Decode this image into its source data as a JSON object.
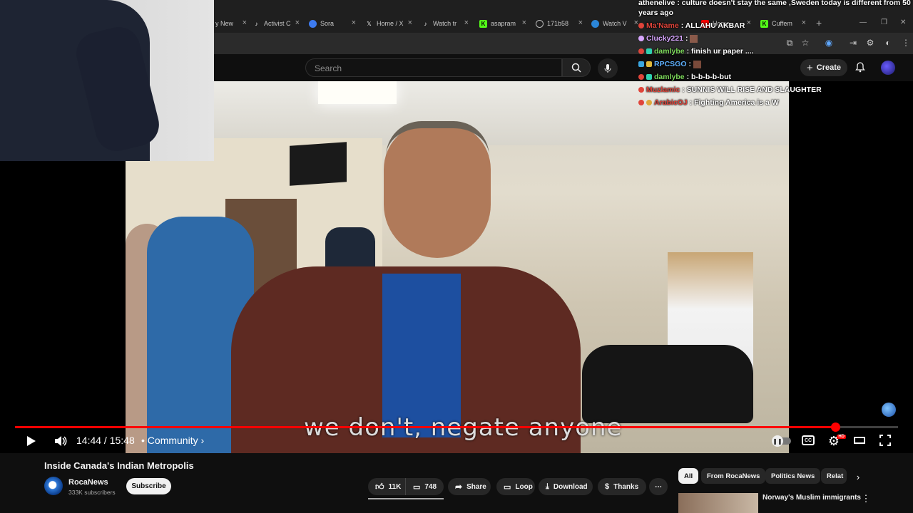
{
  "browser": {
    "tabs": [
      {
        "label": "y New",
        "icon": ""
      },
      {
        "label": "Activist C",
        "icon": "tiktok-icon"
      },
      {
        "label": "Sora",
        "icon": "sora-icon"
      },
      {
        "label": "Home / X",
        "icon": "x-icon"
      },
      {
        "label": "Watch tr",
        "icon": "tiktok-icon"
      },
      {
        "label": "asapram",
        "icon": "kick-icon"
      },
      {
        "label": "171b58",
        "icon": "globe-icon"
      },
      {
        "label": "Watch V",
        "icon": "play-icon"
      },
      {
        "label": "Home",
        "icon": ""
      },
      {
        "label": "Cuffem",
        "icon": "kick-icon"
      }
    ]
  },
  "masthead": {
    "search_placeholder": "Search",
    "create_label": "Create"
  },
  "chat": [
    {
      "user": "athenelive",
      "message": ": culture doesn't stay the same ,Sweden today is different from 50",
      "user_color": "#ffffff"
    },
    {
      "user": "",
      "message": "years ago",
      "user_color": "#ffffff"
    },
    {
      "user": "Ma'Name",
      "message": ": ALLAHU AKBAR",
      "user_color": "#e0443a"
    },
    {
      "user": "Clucky221",
      "message": ":",
      "user_color": "#d8a6ff"
    },
    {
      "user": "damlybe",
      "message": ": finish ur paper ....",
      "user_color": "#7dd95b"
    },
    {
      "user": "RPCSGO",
      "message": ":",
      "user_color": "#5fb1ff"
    },
    {
      "user": "damlybe",
      "message": ": b-b-b-b-but",
      "user_color": "#7dd95b"
    },
    {
      "user": "Muzlamic",
      "message": ": SUNNIS WILL RISE AND SLAUGHTER",
      "user_color": "#e0443a"
    },
    {
      "user": "ArabicOJ",
      "message": ": Fighting America is a W",
      "user_color": "#e0443a"
    }
  ],
  "player": {
    "subtitle": "we don't, negate anyone",
    "time": "14:44 / 15:48",
    "chapter": "• Community ›",
    "progress": 0.929,
    "hd_badge": "HD"
  },
  "video": {
    "title": "Inside Canada's Indian Metropolis",
    "channel": "RocaNews",
    "subscribers": "333K subscribers",
    "subscribe_label": "Subscribe",
    "likes": "11K",
    "comments": "748",
    "share_label": "Share",
    "loop_label": "Loop",
    "download_label": "Download",
    "thanks_label": "Thanks"
  },
  "chips": [
    "All",
    "From RocaNews",
    "Politics News",
    "Relat"
  ],
  "recommendation": {
    "title": "Norway's Muslim immigrants"
  },
  "colors": {
    "accent": "#ff0000",
    "background": "#0f0f0f"
  }
}
